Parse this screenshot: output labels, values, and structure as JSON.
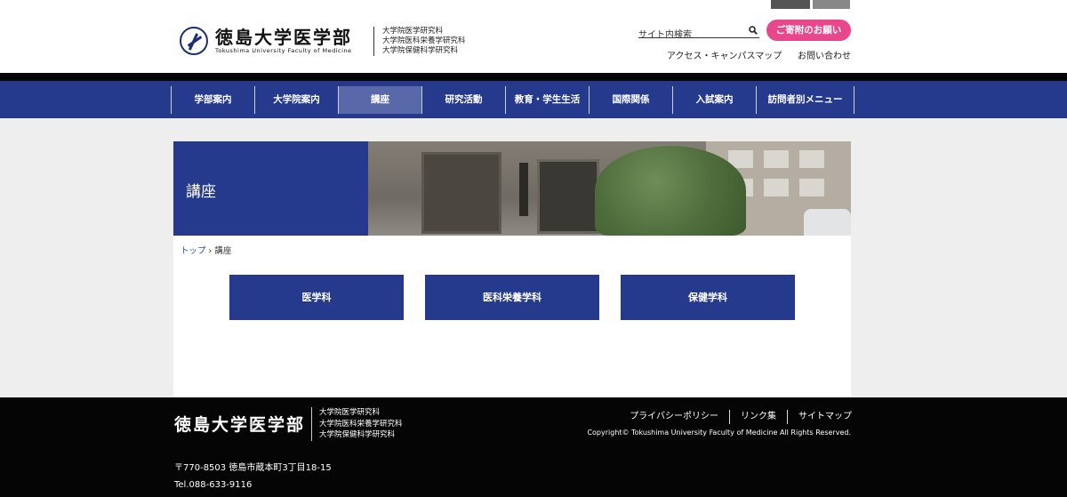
{
  "header": {
    "logo_ja": "徳島大学医学部",
    "logo_en": "Tokushima University Faculty of Medicine",
    "graduate_schools": [
      "大学院医学研究科",
      "大学院医科栄養学研究科",
      "大学院保健科学研究科"
    ],
    "search_placeholder": "サイト内検索",
    "donate_label": "ご寄附のお願い",
    "access_label": "アクセス・キャンパスマップ",
    "contact_label": "お問い合わせ"
  },
  "nav": {
    "items": [
      "学部案内",
      "大学院案内",
      "講座",
      "研究活動",
      "教育・学生生活",
      "国際関係",
      "入試案内",
      "訪問者別メニュー"
    ],
    "active_index": 2
  },
  "page": {
    "title": "講座",
    "breadcrumb_home": "トップ",
    "breadcrumb_sep": " › ",
    "breadcrumb_current": "講座",
    "departments": [
      "医学科",
      "医科栄養学科",
      "保健学科"
    ]
  },
  "footer": {
    "logo_ja": "徳島大学医学部",
    "graduate_schools": [
      "大学院医学研究科",
      "大学院医科栄養学研究科",
      "大学院保健科学研究科"
    ],
    "links": [
      "プライバシーポリシー",
      "リンク集",
      "サイトマップ"
    ],
    "copyright": "Copyright© Tokushima University Faculty of Medicine All Rights Reserved.",
    "address": "〒770-8503 徳島市蔵本町3丁目18-15",
    "tel": "Tel.088-633-9116"
  },
  "colors": {
    "primary": "#253a8c",
    "nav_active": "#5868a9",
    "donate": "#e8478b",
    "footer_bg": "#050505"
  }
}
